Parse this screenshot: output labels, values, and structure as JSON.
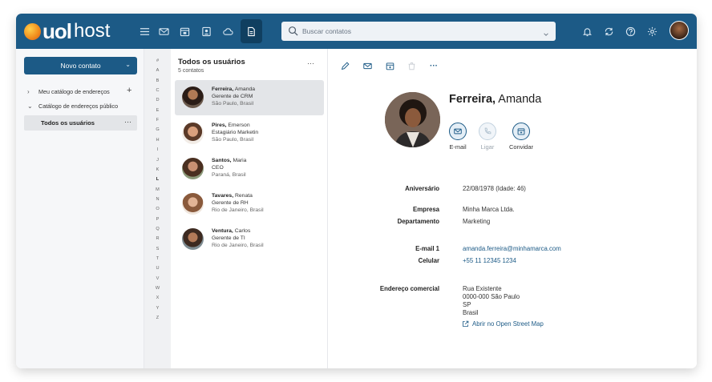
{
  "brand": {
    "name_bold": "uol",
    "name_light": "host"
  },
  "topbar": {
    "icons": [
      "menu-icon",
      "mail-icon",
      "calendar-icon",
      "contacts-icon",
      "cloud-icon",
      "documents-icon"
    ],
    "search_placeholder": "Buscar contatos",
    "right_icons": [
      "bell-icon",
      "sync-icon",
      "help-icon",
      "settings-icon"
    ]
  },
  "sidebar": {
    "new_contact": "Novo contato",
    "items": [
      {
        "label": "Meu catálogo de endereços",
        "chevron": "›"
      },
      {
        "label": "Catálogo de endereços público",
        "chevron": "⌄"
      }
    ],
    "selected": {
      "label": "Todos os usuários",
      "menu": "···"
    }
  },
  "alphabet": [
    "#",
    "A",
    "B",
    "C",
    "D",
    "E",
    "F",
    "G",
    "H",
    "I",
    "J",
    "K",
    "L",
    "M",
    "N",
    "O",
    "P",
    "Q",
    "R",
    "S",
    "T",
    "U",
    "V",
    "W",
    "X",
    "Y",
    "Z"
  ],
  "list": {
    "title": "Todos os usuários",
    "count": "5 contatos",
    "menu": "···",
    "contacts": [
      {
        "surname": "Ferreira,",
        "given": " Amanda",
        "role": "Gerente de CRM",
        "location": "São Paulo, Brasil",
        "selected": true
      },
      {
        "surname": "Pires,",
        "given": " Emerson",
        "role": "Estagiário Marketin",
        "location": "São Paulo, Brasil",
        "selected": false
      },
      {
        "surname": "Santos,",
        "given": " Maria",
        "role": "CEO",
        "location": "Paraná, Brasil",
        "selected": false
      },
      {
        "surname": "Tavares,",
        "given": " Renata",
        "role": "Gerente de RH",
        "location": "Rio de Janeiro, Brasil",
        "selected": false
      },
      {
        "surname": "Ventura,",
        "given": " Carlos",
        "role": "Gerente de TI",
        "location": "Rio de Janeiro, Brasil",
        "selected": false
      }
    ]
  },
  "detail": {
    "toolbar_menu": "···",
    "name_bold": "Ferreira,",
    "name_rest": " Amanda",
    "actions": [
      {
        "label": "E-mail",
        "enabled": true
      },
      {
        "label": "Ligar",
        "enabled": false
      },
      {
        "label": "Convidar",
        "enabled": true
      }
    ],
    "fields": {
      "birthday_label": "Aniversário",
      "birthday_value": "22/08/1978 (Idade: 46)",
      "company_label": "Empresa",
      "company_value": "Minha Marca Ltda.",
      "department_label": "Departamento",
      "department_value": "Marketing",
      "email_label": "E-mail 1",
      "email_value": "amanda.ferreira@minhamarca.com",
      "mobile_label": "Celular",
      "mobile_value": "+55 11 12345 1234",
      "address_label": "Endereço comercial",
      "address_line1": "Rua Existente",
      "address_line2": "0000-000 São Paulo",
      "address_line3": "SP",
      "address_line4": "Brasil",
      "map_link": "Abrir no Open Street Map"
    }
  },
  "colors": {
    "brand_blue": "#1c5a86",
    "selected_gray": "#e3e5e8"
  }
}
